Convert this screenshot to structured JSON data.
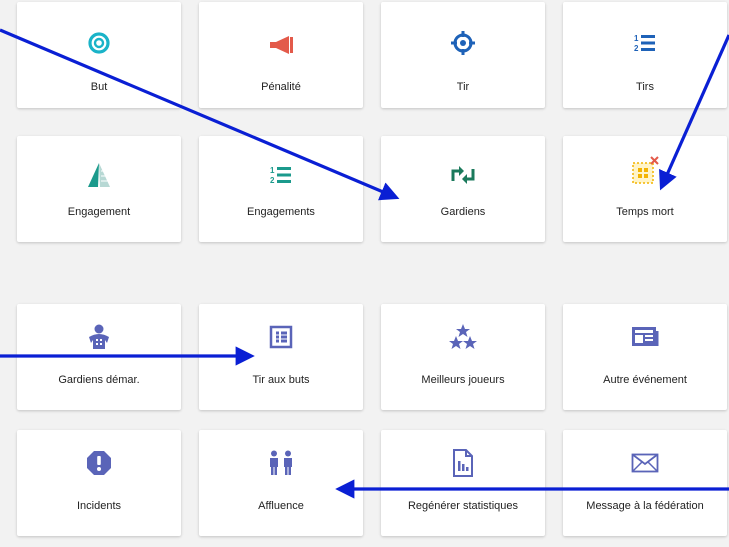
{
  "colors": {
    "background": "#f2f2f2",
    "card": "#ffffff",
    "annotation_arrow": "#0a1fd4",
    "icon_cyan": "#1ab3c8",
    "icon_red": "#e35a4a",
    "icon_blue": "#1e62b8",
    "icon_green": "#1b7a5c",
    "icon_orange": "#f4b400",
    "icon_indigo": "#5a64b8"
  },
  "tiles": {
    "but": {
      "label": "But",
      "icon": "target-ring-icon"
    },
    "penalite": {
      "label": "Pénalité",
      "icon": "megaphone-icon"
    },
    "tir": {
      "label": "Tir",
      "icon": "crosshair-icon"
    },
    "tirs": {
      "label": "Tirs",
      "icon": "numbered-list-icon"
    },
    "engagement": {
      "label": "Engagement",
      "icon": "triangle-split-icon"
    },
    "engagements": {
      "label": "Engagements",
      "icon": "numbered-list-icon"
    },
    "gardiens": {
      "label": "Gardiens",
      "icon": "swap-arrows-icon"
    },
    "temps_mort": {
      "label": "Temps mort",
      "icon": "grid-cancel-icon"
    },
    "gardiens_demar": {
      "label": "Gardiens démar.",
      "icon": "goalie-person-icon"
    },
    "tir_aux_buts": {
      "label": "Tir aux buts",
      "icon": "list-box-icon"
    },
    "meilleurs_joueurs": {
      "label": "Meilleurs joueurs",
      "icon": "three-stars-icon"
    },
    "autre_evenement": {
      "label": "Autre événement",
      "icon": "newspaper-icon"
    },
    "incidents": {
      "label": "Incidents",
      "icon": "exclamation-octagon-icon"
    },
    "affluence": {
      "label": "Affluence",
      "icon": "people-icon"
    },
    "regenerer_statistiques": {
      "label": "Regénérer statistiques",
      "icon": "file-chart-icon"
    },
    "message_federation": {
      "label": "Message à la fédération",
      "icon": "envelope-icon"
    }
  }
}
